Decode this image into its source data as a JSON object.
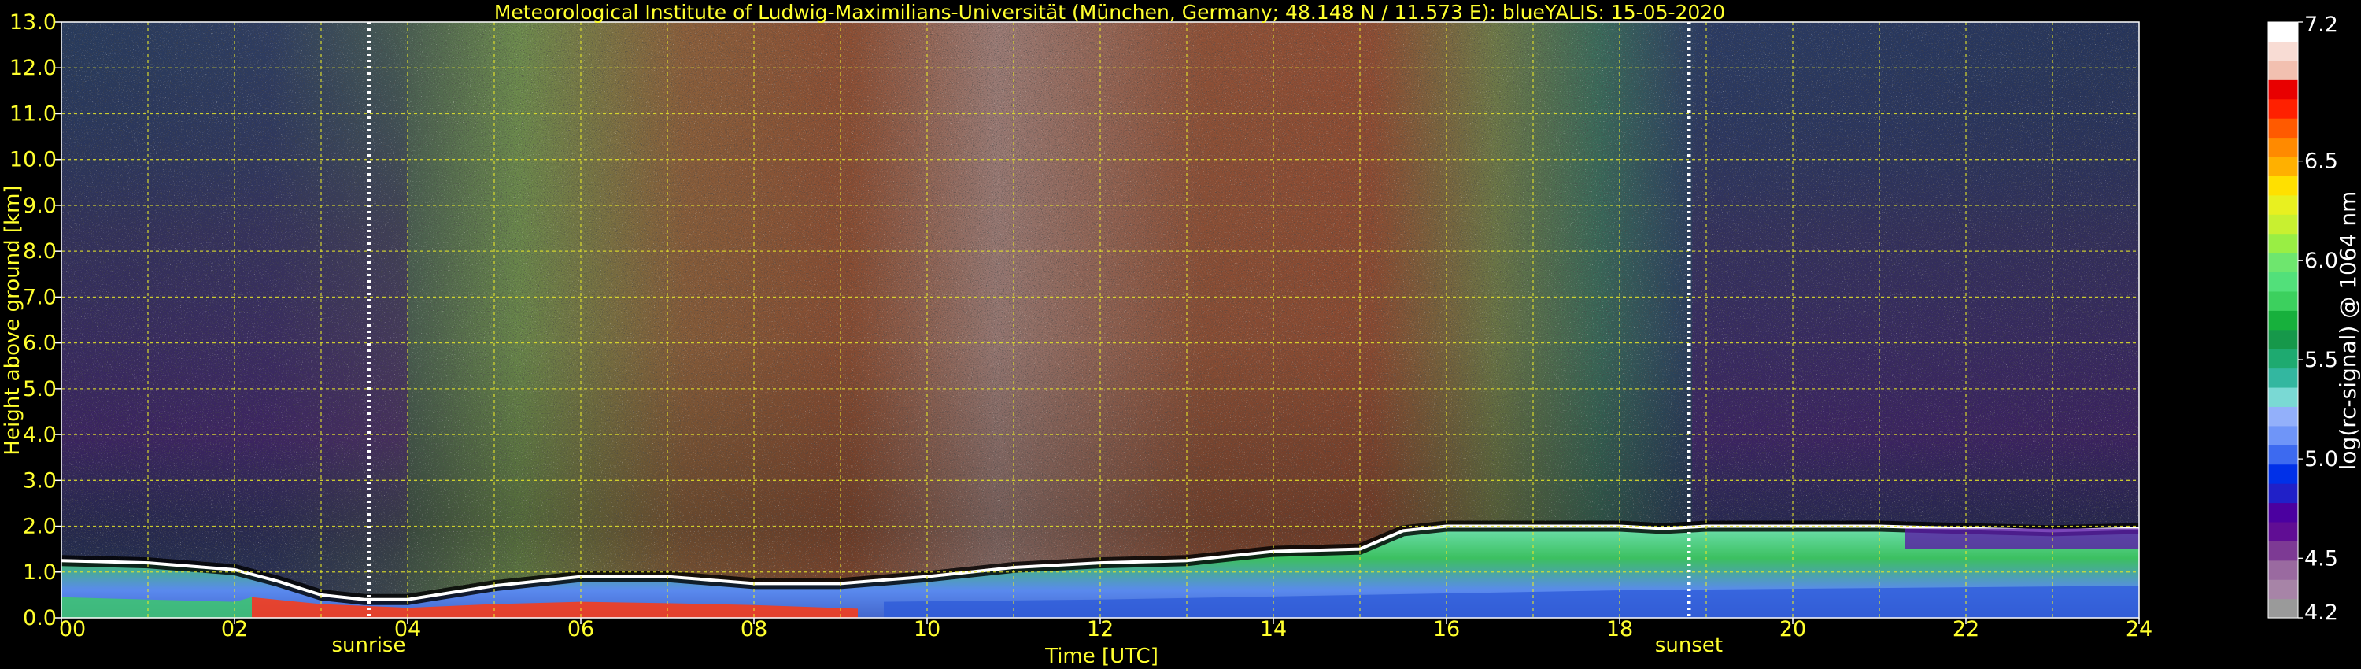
{
  "chart_data": {
    "type": "heatmap",
    "title": "Meteorological Institute of Ludwig-Maximilians-Universität (München, Germany; 48.148 N / 11.573 E):    blueYALIS: 15-05-2020",
    "xlabel": "Time [UTC]",
    "ylabel": "Height above ground [km]",
    "xlim": [
      0,
      24
    ],
    "ylim": [
      0,
      13
    ],
    "x_ticks": [
      "00",
      "02",
      "04",
      "06",
      "08",
      "10",
      "12",
      "14",
      "16",
      "18",
      "20",
      "22",
      "24"
    ],
    "y_ticks": [
      "0.0",
      "1.0",
      "2.0",
      "3.0",
      "4.0",
      "5.0",
      "6.0",
      "7.0",
      "8.0",
      "9.0",
      "10.0",
      "11.0",
      "12.0",
      "13.0"
    ],
    "grid": true,
    "events": [
      {
        "label": "sunrise",
        "time_utc": 3.55
      },
      {
        "label": "sunset",
        "time_utc": 18.8
      }
    ],
    "colorbar": {
      "label": "log(rc-signal) @ 1064 nm",
      "min": 4.2,
      "max": 7.2,
      "tick_values": [
        4.5,
        5.0,
        5.5,
        6.0,
        6.5,
        7.2
      ],
      "tick_labels": [
        "4.2",
        "4.5",
        "5.0",
        "5.5",
        "6.0",
        "6.5",
        "7.2"
      ],
      "colors": [
        "#9a9a9a",
        "#a784a7",
        "#9a6aa0",
        "#7d3a94",
        "#600d94",
        "#4b00a0",
        "#2020c8",
        "#0030e8",
        "#3d6af0",
        "#6f95f8",
        "#93b0fa",
        "#7ad9d4",
        "#33b7a0",
        "#1eaa70",
        "#16984a",
        "#17b03c",
        "#3cd05e",
        "#52e07a",
        "#6ee66e",
        "#99ee44",
        "#c8f030",
        "#e8f020",
        "#ffe000",
        "#ffb000",
        "#ff8a00",
        "#ff5a00",
        "#ff2000",
        "#e80000",
        "#f2c0b0",
        "#f8dcd4",
        "#ffffff"
      ]
    },
    "profile": {
      "description_units": "boundary-layer top height [km] vs time [UTC]",
      "x": [
        0,
        1,
        2,
        2.5,
        3,
        3.5,
        4,
        5,
        6,
        7,
        8,
        9,
        10,
        11,
        12,
        13,
        14,
        15,
        15.5,
        16,
        17,
        18,
        18.5,
        19,
        20,
        21,
        22,
        23,
        24
      ],
      "y": [
        1.25,
        1.2,
        1.05,
        0.8,
        0.5,
        0.4,
        0.4,
        0.7,
        0.9,
        0.9,
        0.75,
        0.75,
        0.9,
        1.1,
        1.2,
        1.25,
        1.45,
        1.5,
        1.9,
        2.0,
        2.0,
        2.0,
        1.95,
        2.0,
        2.0,
        2.0,
        1.95,
        1.9,
        1.95
      ]
    }
  }
}
